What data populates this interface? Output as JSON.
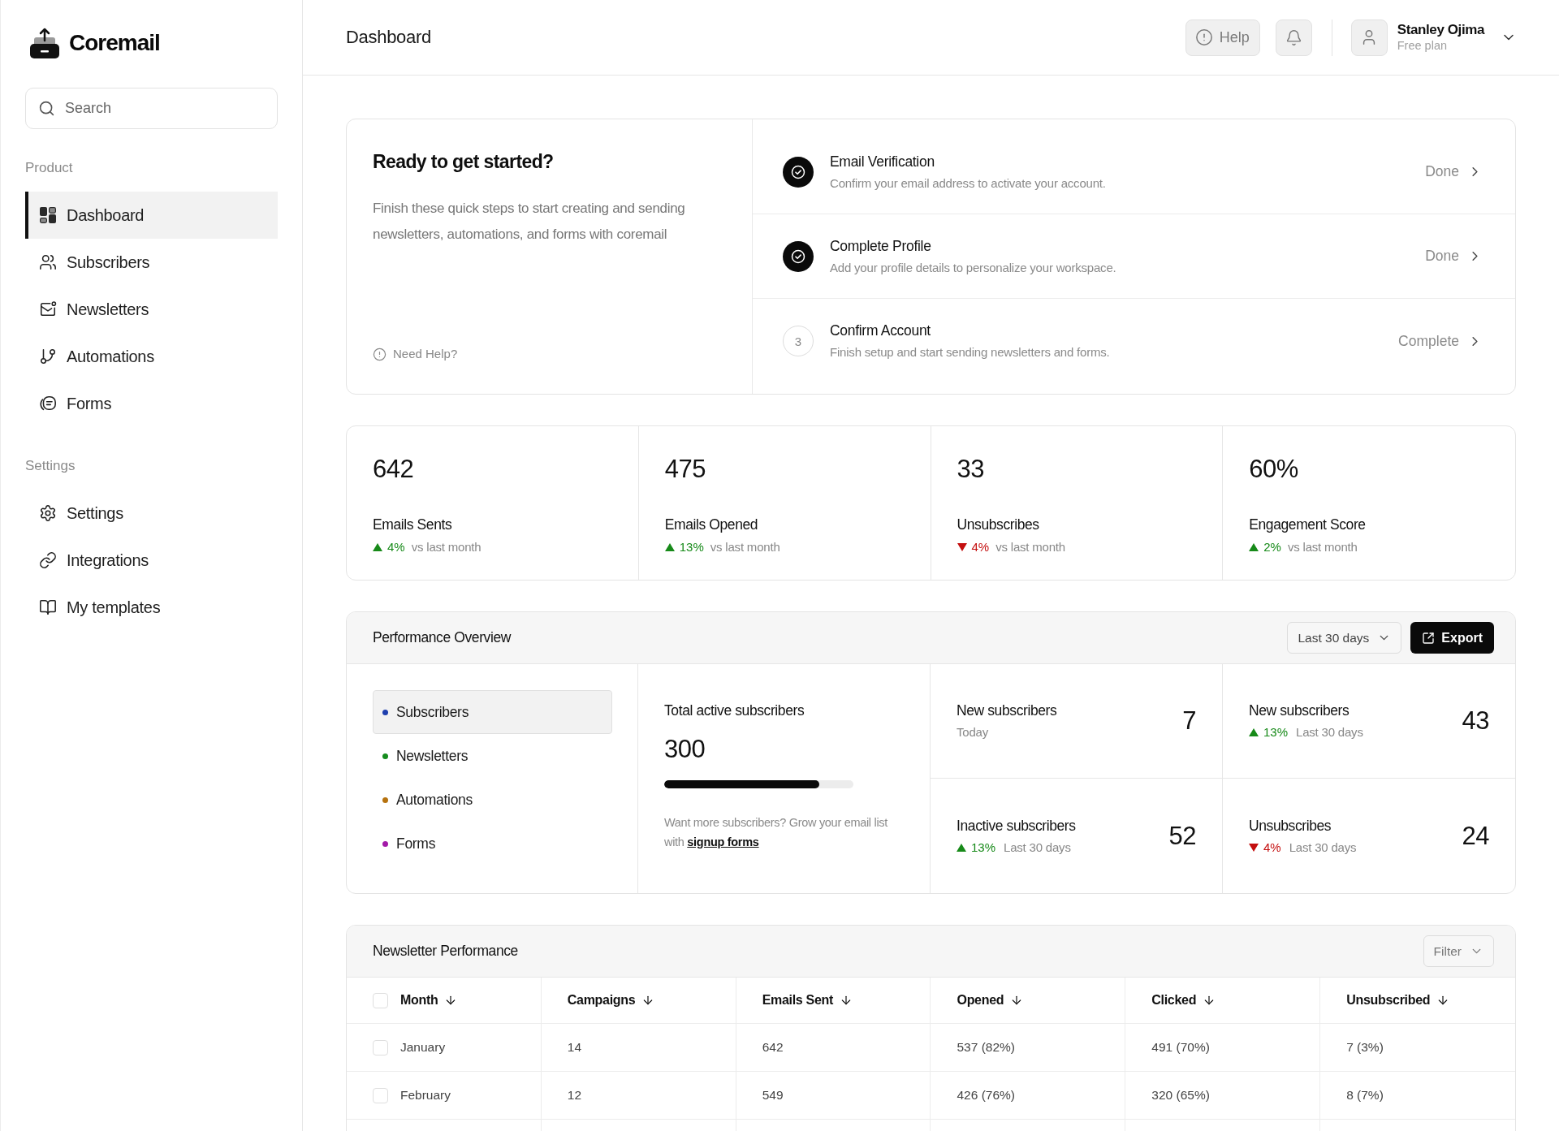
{
  "sidebar": {
    "brand": "Coremail",
    "search": {
      "placeholder": "Search"
    },
    "sections": [
      {
        "label": "Product",
        "items": [
          {
            "label": "Dashboard",
            "selected": true
          },
          {
            "label": "Subscribers",
            "selected": false
          },
          {
            "label": "Newsletters",
            "selected": false
          },
          {
            "label": "Automations",
            "selected": false
          },
          {
            "label": "Forms",
            "selected": false
          }
        ]
      },
      {
        "label": "Settings",
        "items": [
          {
            "label": "Settings",
            "selected": false
          },
          {
            "label": "Integrations",
            "selected": false
          },
          {
            "label": "My templates",
            "selected": false
          }
        ]
      }
    ]
  },
  "header": {
    "title": "Dashboard",
    "help_button": "Help",
    "user": {
      "name": "Stanley Ojima",
      "plan": "Free plan"
    }
  },
  "getting_started": {
    "title": "Ready to get started?",
    "description": "Finish these quick steps to start creating and sending newsletters, automations, and forms with coremail",
    "help_link": "Need Help?",
    "steps": [
      {
        "title": "Email Verification",
        "description": "Confirm your email address to activate your account.",
        "status": "Done",
        "done": true
      },
      {
        "title": "Complete Profile",
        "description": "Add your profile details to personalize your workspace.",
        "status": "Done",
        "done": true
      },
      {
        "title": "Confirm Account",
        "description": "Finish setup and start sending newsletters and forms.",
        "status": "Complete",
        "done": false,
        "number": "3"
      }
    ]
  },
  "stats": [
    {
      "value": "642",
      "label": "Emails Sents",
      "change": "4%",
      "increase": true,
      "comparison": "vs last month"
    },
    {
      "value": "475",
      "label": "Emails Opened",
      "change": "13%",
      "increase": true,
      "comparison": "vs last month"
    },
    {
      "value": "33",
      "label": "Unsubscribes",
      "change": "4%",
      "increase": false,
      "comparison": "vs last month"
    },
    {
      "value": "60%",
      "label": "Engagement Score",
      "change": "2%",
      "increase": true,
      "comparison": "vs last month"
    }
  ],
  "performance": {
    "title": "Performance Overview",
    "range": "Last 30 days",
    "export_button": "Export",
    "categories": [
      {
        "label": "Subscribers",
        "color": "#1e3fae",
        "selected": true
      },
      {
        "label": "Newsletters",
        "color": "#168c1e",
        "selected": false
      },
      {
        "label": "Automations",
        "color": "#b6720f",
        "selected": false
      },
      {
        "label": "Forms",
        "color": "#a31aa8",
        "selected": false
      }
    ],
    "total": {
      "label": "Total active subscribers",
      "value": "300",
      "level": 0.82,
      "note": "Want more subscribers? Grow your email list with",
      "link": "signup forms"
    },
    "metrics": [
      {
        "label": "New subscribers",
        "value": "7",
        "period": "Today"
      },
      {
        "label": "New subscribers",
        "value": "43",
        "change": "13%",
        "increase": true,
        "period": "Last 30 days"
      },
      {
        "label": "Inactive subscribers",
        "value": "52",
        "change": "13%",
        "increase": true,
        "period": "Last 30 days"
      },
      {
        "label": "Unsubscribes",
        "value": "24",
        "change": "4%",
        "increase": false,
        "period": "Last 30 days"
      }
    ]
  },
  "newsletter_table": {
    "title": "Newsletter Performance",
    "filter_button": "Filter",
    "select_all": {
      "checked": false
    },
    "columns": [
      "Month",
      "Campaigns",
      "Emails Sent",
      "Opened",
      "Clicked",
      "Unsubscribed"
    ],
    "rows": [
      {
        "checked": false,
        "cells": [
          "January",
          "14",
          "642",
          "537 (82%)",
          "491 (70%)",
          "7 (3%)"
        ]
      },
      {
        "checked": false,
        "cells": [
          "February",
          "12",
          "549",
          "426 (76%)",
          "320 (65%)",
          "8 (7%)"
        ]
      }
    ]
  }
}
